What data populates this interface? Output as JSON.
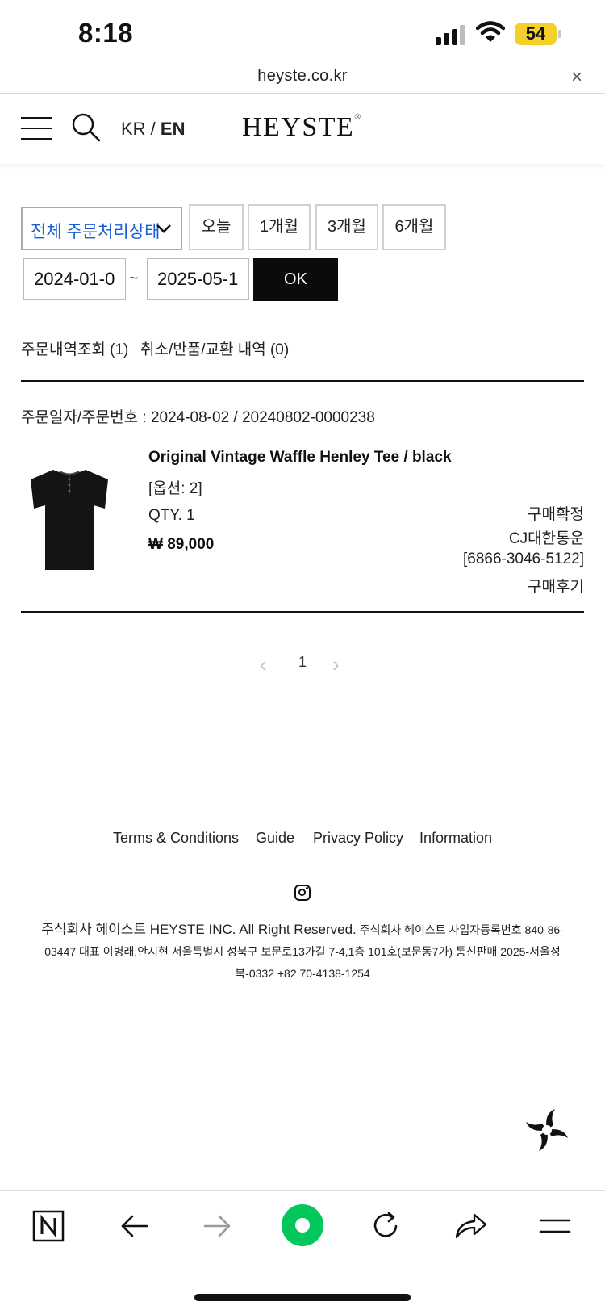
{
  "status_bar": {
    "time": "8:18",
    "battery": "54"
  },
  "browser": {
    "url": "heyste.co.kr",
    "close_icon": "×"
  },
  "header": {
    "lang_kr": "KR",
    "lang_sep": " / ",
    "lang_en": "EN",
    "logo": "HEYSTE",
    "logo_mark": "®"
  },
  "filters": {
    "status_select": "전체 주문처리상태",
    "ranges": [
      "오늘",
      "1개월",
      "3개월",
      "6개월"
    ],
    "date_from": "2024-01-0",
    "date_sep": "~",
    "date_to": "2025-05-1",
    "ok_label": "OK"
  },
  "tabs": [
    "주문내역조회 (1)",
    "취소/반품/교환 내역 (0)"
  ],
  "order": {
    "meta_label": "주문일자/주문번호 : 2024-08-02 / ",
    "order_no": "20240802-0000238",
    "product_name": "Original Vintage Waffle Henley Tee / black",
    "option": "[옵션: 2]",
    "qty": "QTY. 1",
    "price": "₩ 89,000",
    "status": "구매확정",
    "courier": "CJ대한통운",
    "tracking": "[6866-3046-5122]",
    "review": "구매후기"
  },
  "pagination": {
    "prev": "‹",
    "page": "1",
    "next": "›"
  },
  "footer": {
    "links": [
      "Terms & Conditions",
      "Guide",
      "Privacy Policy",
      "Information"
    ],
    "company_main": "주식회사 헤이스트 HEYSTE INC. All Right Reserved.",
    "company_line1_rest": " 주식회사 헤이스트 사업자등록번호 840-86-",
    "company_line2": "03447 대표 이병래,안시현 서울특별시 성북구 보문로13가길 7-4,1층 101호(보문동7가) 통신판매 2025-서울성",
    "company_line3": "북-0332 +82 70-4138-1254"
  },
  "colors": {
    "accent_blue": "#1a5fd8",
    "battery_yellow": "#f5cf2a",
    "naver_green": "#03c75a"
  },
  "icons": [
    "menu-icon",
    "search-icon",
    "chevron-down-icon",
    "instagram-icon",
    "naver-n-icon",
    "back-arrow-icon",
    "forward-arrow-icon",
    "green-dot-icon",
    "reload-icon",
    "share-icon",
    "menu-lines-icon"
  ]
}
